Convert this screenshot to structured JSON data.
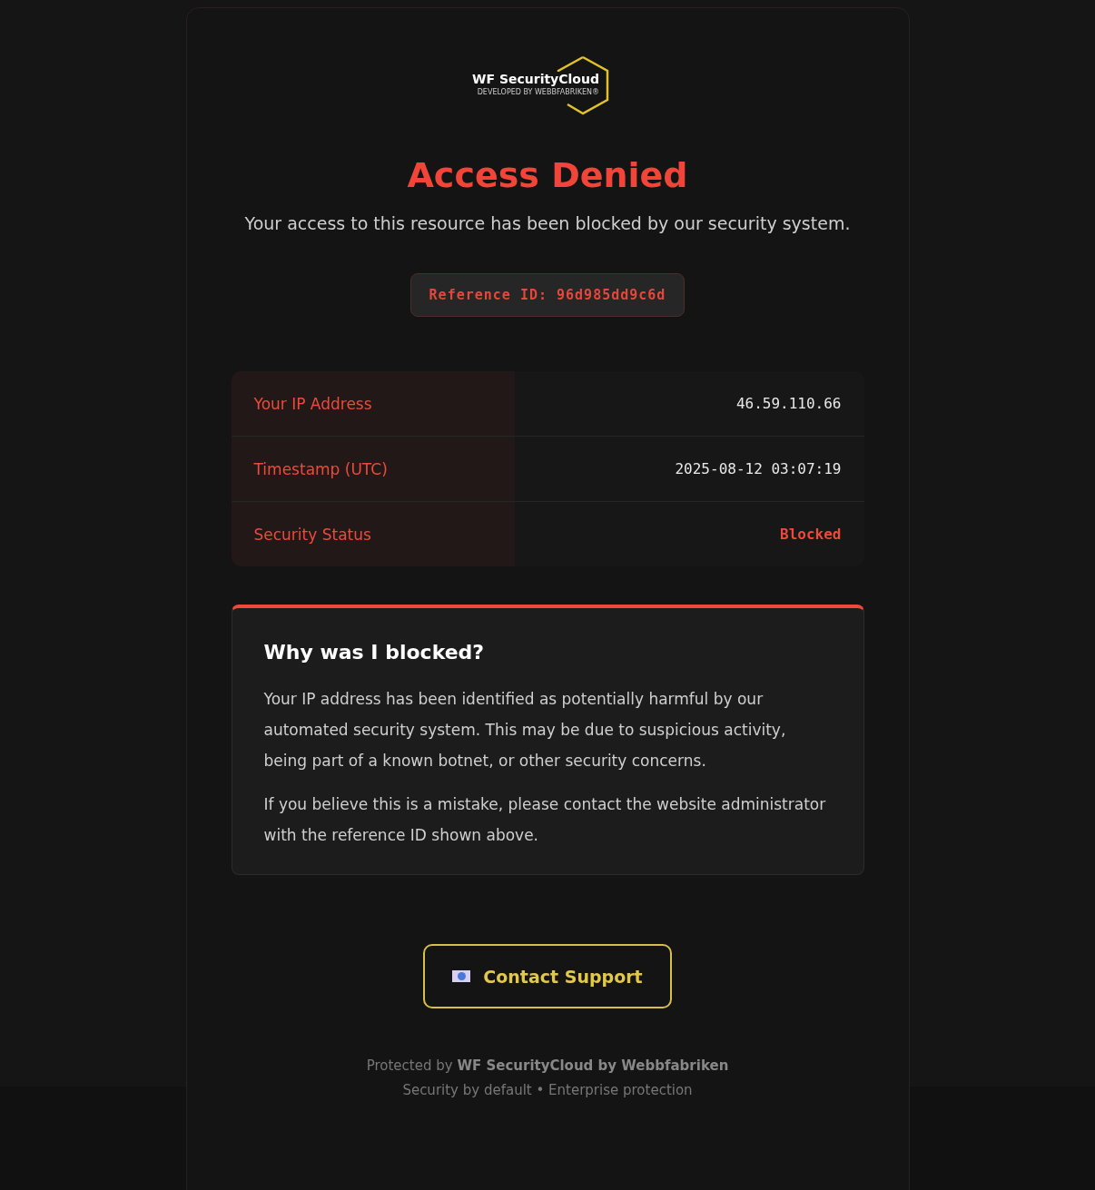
{
  "logo": {
    "name": "WF SecurityCloud",
    "tagline": "DEVELOPED BY WEBBFABRIKEN®"
  },
  "title": "Access Denied",
  "subtitle": "Your access to this resource has been blocked by our security system.",
  "reference": "Reference ID: 96d985dd9c6d",
  "details": [
    {
      "label": "Your IP Address",
      "value": "46.59.110.66",
      "kind": "text"
    },
    {
      "label": "Timestamp (UTC)",
      "value": "2025-08-12 03:07:19",
      "kind": "text"
    },
    {
      "label": "Security Status",
      "value": "Blocked",
      "kind": "status"
    }
  ],
  "explanation": {
    "heading": "Why was I blocked?",
    "paragraphs": [
      "Your IP address has been identified as potentially harmful by our automated security system. This may be due to suspicious activity, being part of a known botnet, or other security concerns.",
      "If you believe this is a mistake, please contact the website administrator with the reference ID shown above."
    ]
  },
  "contact_button": "Contact Support",
  "footer": {
    "line_1": "Protected by **WF SecurityCloud by Webbfabriken**",
    "line_2": "Security by default • Enterprise protection"
  }
}
